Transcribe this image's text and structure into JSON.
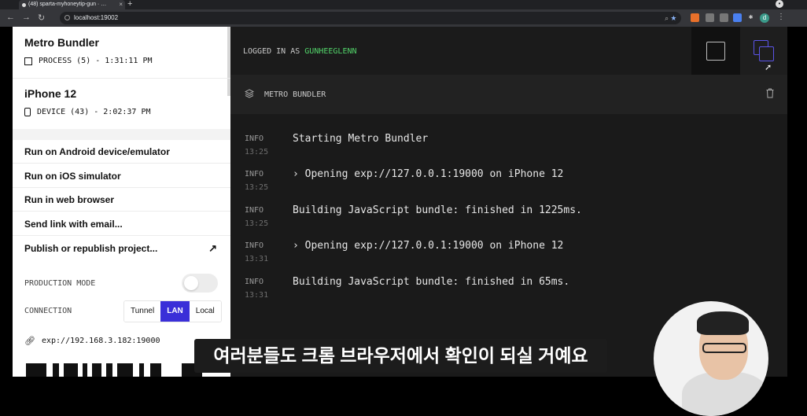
{
  "browser": {
    "tab_title": "(48) sparta-myhoneytip-gun · …",
    "url": "localhost:19002",
    "extension_colors": [
      "#e8702a",
      "#777777",
      "#777777",
      "#4a80f0",
      "#3b9a8a"
    ],
    "profile_initial": "d"
  },
  "sidebar": {
    "process": {
      "title": "Metro Bundler",
      "sub": "PROCESS (5) - 1:31:11 PM",
      "icon": "cube-icon"
    },
    "device": {
      "title": "iPhone 12",
      "sub": "DEVICE (43) - 2:02:37 PM",
      "icon": "phone-icon"
    },
    "actions": [
      {
        "label": "Run on Android device/emulator"
      },
      {
        "label": "Run on iOS simulator"
      },
      {
        "label": "Run in web browser"
      },
      {
        "label": "Send link with email..."
      },
      {
        "label": "Publish or republish project...",
        "icon": "arrow-up-right-icon"
      }
    ],
    "production_mode_label": "PRODUCTION MODE",
    "production_mode_on": false,
    "connection_label": "CONNECTION",
    "connection_options": [
      "Tunnel",
      "LAN",
      "Local"
    ],
    "connection_selected": "LAN",
    "exp_url": "exp://192.168.3.182:19000"
  },
  "header": {
    "logged_prefix": "LOGGED IN AS",
    "username": "GUNHEEGLENN",
    "accent": "#5b54e8",
    "user_color": "#52d46a"
  },
  "panel": {
    "title": "METRO BUNDLER",
    "logs": [
      {
        "level": "INFO",
        "time": "13:25",
        "message": "Starting Metro Bundler"
      },
      {
        "level": "INFO",
        "time": "13:25",
        "message": "› Opening exp://127.0.0.1:19000 on iPhone 12"
      },
      {
        "level": "INFO",
        "time": "13:25",
        "message": "Building JavaScript bundle: finished in 1225ms."
      },
      {
        "level": "INFO",
        "time": "13:31",
        "message": "› Opening exp://127.0.0.1:19000 on iPhone 12"
      },
      {
        "level": "INFO",
        "time": "13:31",
        "message": "Building JavaScript bundle: finished in 65ms."
      }
    ]
  },
  "overlay": {
    "subtitle": "여러분들도 크롬 브라우저에서 확인이 되실 거예요"
  }
}
